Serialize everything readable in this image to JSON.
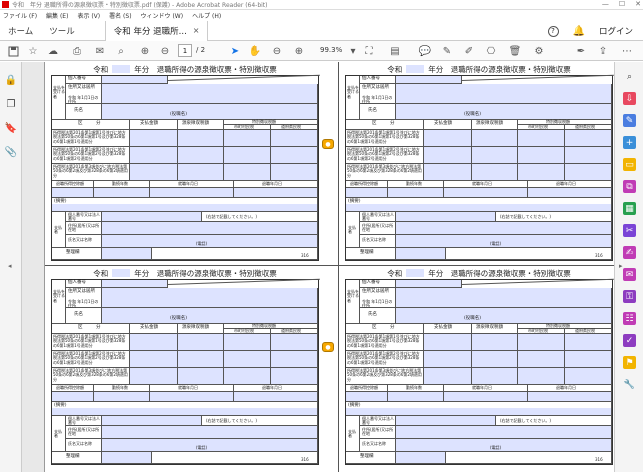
{
  "window": {
    "title": "令和　年分 退職所得の源泉徴収票・特別徴収票.pdf (保護) - Adobe Acrobat Reader (64-bit)",
    "controls": [
      "—",
      "☐",
      "✕"
    ]
  },
  "menu": [
    "ファイル (F)",
    "編集 (E)",
    "表示 (V)",
    "署名 (S)",
    "ウィンドウ (W)",
    "ヘルプ (H)"
  ],
  "tabs": {
    "home": "ホーム",
    "tools": "ツール",
    "document": "令和 年分 退職所...",
    "close": "×",
    "help": "?",
    "login": "ログイン"
  },
  "toolbar": {
    "page_current": "1",
    "page_total": "/ 2",
    "zoom": "99.3%"
  },
  "slip": {
    "title_prefix": "令和",
    "title_suffix": "年分　退職所得の源泉徴収票・特別徴収票",
    "payee_label": "支払を受ける者",
    "my_number": "個人番号",
    "address": "住所又は居所",
    "address_date": "令和 年1月1日の住所",
    "name": "氏名",
    "role": "(役職名)",
    "category": "区　　　分",
    "pay_amount": "支払金額",
    "withheld_income_tax": "源泉徴収税額",
    "special_city_tax": "特別徴収税額",
    "city_tax": "市町村民税",
    "pref_tax": "道府県民税",
    "row1": "所得税法第201条第1項第1号並びに地方税法第50条の6第1項第1号及び第328条の6第1項第1号適用分",
    "row2": "所得税法第201条第1項第2号並びに地方税法第50条の6第1項第2号及び第328条の6第1項第2号適用分",
    "row3": "所得税法第201条第3項並びに地方税法第50条の6第2項及び第328条の6第2項適用分",
    "deduction": "退職所得控除額",
    "years_service": "勤続年数",
    "employment_date": "就職年月日",
    "retire_date": "退職年月日",
    "memo": "(摘要)",
    "payer_label": "支払者",
    "payer_number": "個人番号又は法人番号",
    "payer_number_note": "(右詰で記載してください。)",
    "payer_address": "住所(居所)又は所在地",
    "payer_name": "氏名又は名称",
    "phone": "(電話)",
    "ledger": "整理欄",
    "code": "316"
  },
  "accent": "#1473e6",
  "form_field_color": "#dde3ff"
}
